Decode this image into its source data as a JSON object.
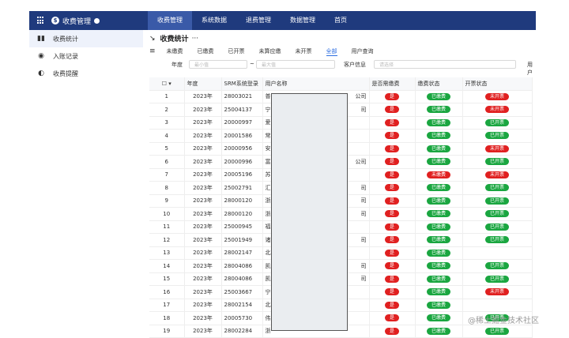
{
  "nav": {
    "app_title": "收费管理",
    "items": [
      {
        "label": "收费管理",
        "active": true
      },
      {
        "label": "系统数据",
        "active": false
      },
      {
        "label": "退费管理",
        "active": false
      },
      {
        "label": "数据管理",
        "active": false
      },
      {
        "label": "首页",
        "active": false
      }
    ]
  },
  "sidebar": {
    "items": [
      {
        "label": "收费统计",
        "icon": "bars-icon",
        "active": true
      },
      {
        "label": "入账记录",
        "icon": "eye-icon",
        "active": false
      },
      {
        "label": "收费提醒",
        "icon": "bell-icon",
        "active": false
      }
    ]
  },
  "page": {
    "title": "收费统计",
    "title_suffix": "···",
    "tabs": [
      {
        "label": "未缴费",
        "active": false
      },
      {
        "label": "已缴费",
        "active": false
      },
      {
        "label": "已开票",
        "active": false
      },
      {
        "label": "未算应缴",
        "active": false
      },
      {
        "label": "未开票",
        "active": false
      },
      {
        "label": "全部",
        "active": true
      },
      {
        "label": "用户查询",
        "active": false
      }
    ],
    "filters": {
      "year_label": "年度",
      "start_placeholder": "最小值",
      "separator": "~",
      "end_placeholder": "最大值",
      "customer_label": "客户信息",
      "customer_placeholder": "请选择",
      "extra_label": "用户"
    }
  },
  "table": {
    "headers": [
      "年度",
      "SRM系统登录",
      "用户名称",
      "是否需缴费",
      "缴费状态",
      "开票状态"
    ],
    "rows": [
      {
        "n": "1",
        "year": "2023年",
        "srm": "28003021",
        "name": "普",
        "suffix": "公司",
        "need": "是",
        "pay": "已缴费",
        "invoice": "未开票"
      },
      {
        "n": "2",
        "year": "2023年",
        "srm": "25004137",
        "name": "宁",
        "suffix": "司",
        "need": "是",
        "pay": "已缴费",
        "invoice": "未开票"
      },
      {
        "n": "3",
        "year": "2023年",
        "srm": "20000997",
        "name": "爱",
        "suffix": "",
        "need": "是",
        "pay": "已缴费",
        "invoice": "已开票"
      },
      {
        "n": "4",
        "year": "2023年",
        "srm": "20001586",
        "name": "常",
        "suffix": "",
        "need": "是",
        "pay": "已缴费",
        "invoice": "已开票"
      },
      {
        "n": "5",
        "year": "2023年",
        "srm": "20000956",
        "name": "安",
        "suffix": "",
        "need": "是",
        "pay": "已缴费",
        "invoice": "未开票"
      },
      {
        "n": "6",
        "year": "2023年",
        "srm": "20000996",
        "name": "富",
        "suffix": "公司",
        "need": "是",
        "pay": "已缴费",
        "invoice": "已开票"
      },
      {
        "n": "7",
        "year": "2023年",
        "srm": "20005196",
        "name": "苏",
        "suffix": "",
        "need": "是",
        "pay": "未缴费",
        "invoice": "未开票"
      },
      {
        "n": "8",
        "year": "2023年",
        "srm": "25002791",
        "name": "汇",
        "suffix": "司",
        "need": "是",
        "pay": "已缴费",
        "invoice": "已开票"
      },
      {
        "n": "9",
        "year": "2023年",
        "srm": "28000120",
        "name": "浙",
        "suffix": "司",
        "need": "是",
        "pay": "已缴费",
        "invoice": "已开票"
      },
      {
        "n": "10",
        "year": "2023年",
        "srm": "28000120",
        "name": "浙",
        "suffix": "司",
        "need": "是",
        "pay": "已缴费",
        "invoice": "已开票"
      },
      {
        "n": "11",
        "year": "2023年",
        "srm": "25000945",
        "name": "福",
        "suffix": "",
        "need": "是",
        "pay": "已缴费",
        "invoice": "已开票"
      },
      {
        "n": "12",
        "year": "2023年",
        "srm": "25001949",
        "name": "诸",
        "suffix": "司",
        "need": "是",
        "pay": "已缴费",
        "invoice": "已开票"
      },
      {
        "n": "13",
        "year": "2023年",
        "srm": "28002147",
        "name": "北",
        "suffix": "",
        "need": "是",
        "pay": "已缴费",
        "invoice": ""
      },
      {
        "n": "14",
        "year": "2023年",
        "srm": "28004086",
        "name": "凯",
        "suffix": "司",
        "need": "是",
        "pay": "已缴费",
        "invoice": "已开票"
      },
      {
        "n": "15",
        "year": "2023年",
        "srm": "28004086",
        "name": "凯",
        "suffix": "司",
        "need": "是",
        "pay": "已缴费",
        "invoice": "已开票"
      },
      {
        "n": "16",
        "year": "2023年",
        "srm": "25003667",
        "name": "宁",
        "suffix": "",
        "need": "是",
        "pay": "已缴费",
        "invoice": "未开票"
      },
      {
        "n": "17",
        "year": "2023年",
        "srm": "28002154",
        "name": "北",
        "suffix": "",
        "need": "是",
        "pay": "已缴费",
        "invoice": ""
      },
      {
        "n": "18",
        "year": "2023年",
        "srm": "20005730",
        "name": "伟",
        "suffix": "",
        "need": "是",
        "pay": "已缴费",
        "invoice": "已开票"
      },
      {
        "n": "19",
        "year": "2023年",
        "srm": "28002284",
        "name": "浙",
        "suffix": "",
        "need": "是",
        "pay": "已缴费",
        "invoice": "已开票"
      }
    ]
  },
  "watermark": "@稀土掘金技术社区",
  "colors": {
    "nav_bg": "#1f3a7d",
    "red": "#e02020",
    "green": "#1aa640",
    "accent": "#2f6fe0"
  }
}
